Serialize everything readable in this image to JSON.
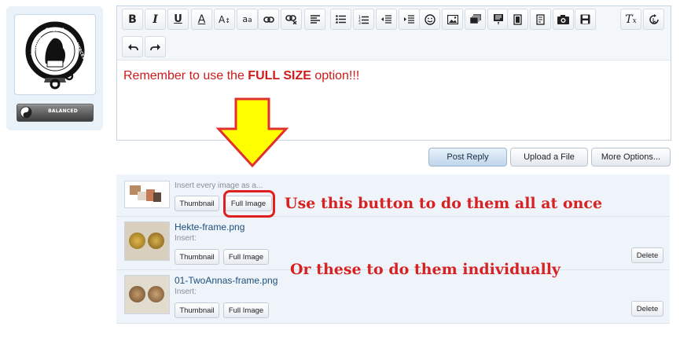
{
  "user": {
    "crest_motto": [
      "VIRTUTIS",
      "GLORIA",
      "MERCES"
    ],
    "badge_label": "BALANCED"
  },
  "toolbar": {
    "buttons": [
      "bold",
      "italic",
      "underline",
      "text-color",
      "font-size",
      "font-family",
      "link",
      "unlink",
      "align",
      "bullet-list",
      "numbered-list",
      "outdent",
      "indent",
      "smilies",
      "image",
      "media",
      "code",
      "quote",
      "spoiler",
      "camera",
      "save-draft",
      "remove-formatting",
      "switch-mode",
      "undo",
      "redo"
    ]
  },
  "editor": {
    "text_before": "Remember to use the ",
    "text_bold": "FULL SIZE",
    "text_after": " option!!!"
  },
  "actions": {
    "post_reply": "Post Reply",
    "upload_file": "Upload a File",
    "more_options": "More Options..."
  },
  "bulk": {
    "insert_label": "Insert every image as a...",
    "thumbnail": "Thumbnail",
    "full_image": "Full Image"
  },
  "attachments": [
    {
      "name": "Hekte-frame.png",
      "insert_label": "Insert:",
      "thumbnail": "Thumbnail",
      "full_image": "Full Image",
      "delete": "Delete"
    },
    {
      "name": "01-TwoAnnas-frame.png",
      "insert_label": "Insert:",
      "thumbnail": "Thumbnail",
      "full_image": "Full Image",
      "delete": "Delete"
    }
  ],
  "annotations": {
    "all_at_once": "Use this button to do them all at once",
    "individually": "Or these to do them individually"
  },
  "colors": {
    "annotation_red": "#d62222",
    "arrow_yellow": "#ffff00",
    "editor_text_red": "#cc1b1b"
  }
}
